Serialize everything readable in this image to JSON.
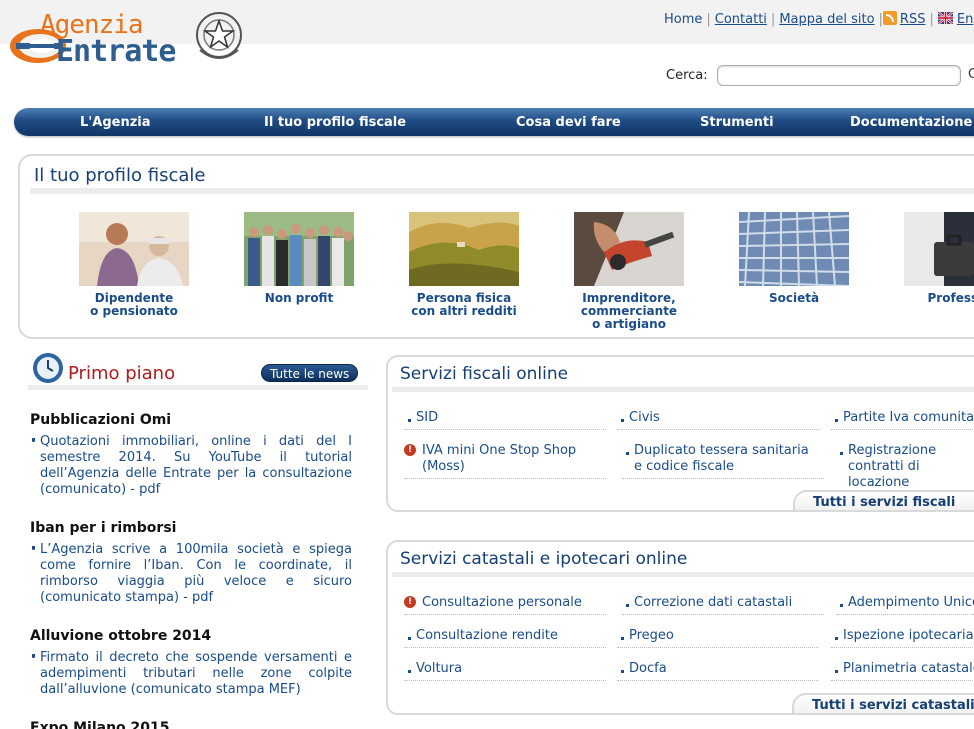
{
  "brand": {
    "logo_line1": "Agenzia",
    "logo_line2": "Entrate",
    "colors": {
      "orange": "#e8731a",
      "blue": "#2f5d8f",
      "nav": "#1f4c84",
      "link": "#1a4c8b",
      "red": "#b01a1a"
    }
  },
  "top_links": [
    {
      "label": "Home",
      "icon": ""
    },
    {
      "label": "Contatti",
      "icon": ""
    },
    {
      "label": "Mappa del sito",
      "icon": ""
    },
    {
      "label": "RSS",
      "icon": "rss-icon"
    },
    {
      "label": "En",
      "icon": "uk-flag-icon"
    }
  ],
  "search": {
    "label": "Cerca:",
    "value": "",
    "placeholder": "",
    "go": "C"
  },
  "nav": [
    "L'Agenzia",
    "Il tuo profilo fiscale",
    "Cosa devi fare",
    "Strumenti",
    "Documentazione"
  ],
  "profile": {
    "title": "Il tuo profilo fiscale",
    "cards": [
      {
        "label": "Dipendente\no pensionato",
        "image": "photo-woman-and-senior"
      },
      {
        "label": "Non profit",
        "image": "photo-group-of-people"
      },
      {
        "label": "Persona fisica\ncon altri redditi",
        "image": "photo-countryside-hills"
      },
      {
        "label": "Imprenditore,\ncommerciante\no artigiano",
        "image": "photo-drill-worker"
      },
      {
        "label": "Società",
        "image": "photo-office-building"
      },
      {
        "label": "Professio",
        "image": "photo-briefcase"
      }
    ]
  },
  "news": {
    "title": "Primo piano",
    "all_button": "Tutte le news",
    "items": [
      {
        "heading": "Pubblicazioni Omi",
        "body": "Quotazioni immobiliari, online i dati del I semestre 2014. Su YouTube il tutorial dell’Agenzia delle Entrate per la consultazione (comunicato) - pdf"
      },
      {
        "heading": "Iban per i rimborsi",
        "body": "L’Agenzia scrive a 100mila società e spiega come fornire l’Iban. Con le coordinate, il rimborso viaggia più veloce e sicuro (comunicato stampa) - pdf"
      },
      {
        "heading": "Alluvione ottobre 2014",
        "body": "Firmato il decreto che sospende versamenti e adempimenti tributari nelle zone colpite dall’alluvione (comunicato stampa MEF)"
      },
      {
        "heading": "Expo Milano 2015",
        "body": ""
      }
    ]
  },
  "services_fiscal": {
    "title": "Servizi fiscali online",
    "links": [
      {
        "label": "SID",
        "warn": false
      },
      {
        "label": "Civis",
        "warn": false
      },
      {
        "label": "Partite Iva comunitarie",
        "warn": false
      },
      {
        "label": "IVA mini One Stop Shop\n(Moss)",
        "warn": true
      },
      {
        "label": "Duplicato tessera sanitaria\ne codice fiscale",
        "warn": false
      },
      {
        "label": "Registrazione contratti di\nlocazione",
        "warn": false
      }
    ],
    "all": "Tutti i servizi fiscali"
  },
  "services_cadastral": {
    "title": "Servizi catastali e ipotecari online",
    "links": [
      {
        "label": "Consultazione personale",
        "warn": true
      },
      {
        "label": "Correzione dati catastali",
        "warn": false
      },
      {
        "label": "Adempimento Unico",
        "warn": false
      },
      {
        "label": "Consultazione rendite",
        "warn": false
      },
      {
        "label": "Pregeo",
        "warn": false
      },
      {
        "label": "Ispezione ipotecaria",
        "warn": false
      },
      {
        "label": "Voltura",
        "warn": false
      },
      {
        "label": "Docfa",
        "warn": false
      },
      {
        "label": "Planimetria catastale",
        "warn": false
      }
    ],
    "all": "Tutti i servizi catastali e ipotecari"
  }
}
